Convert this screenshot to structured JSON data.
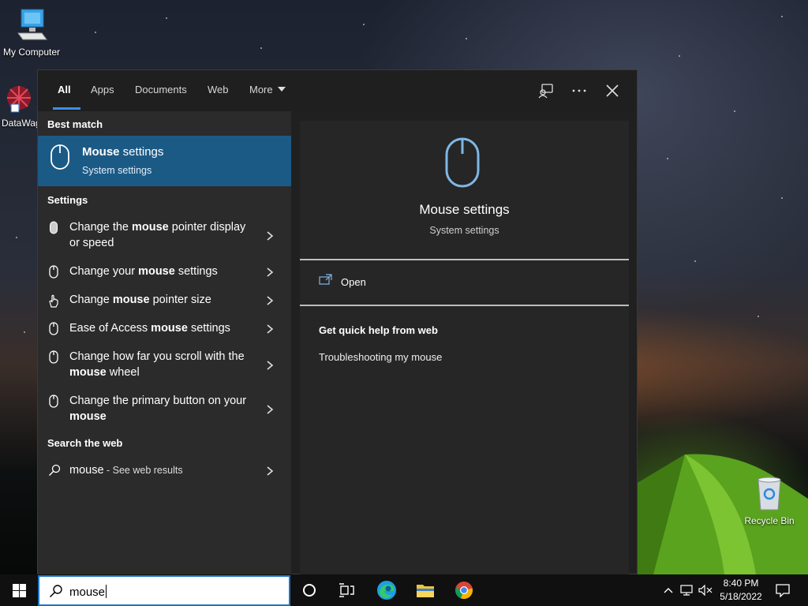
{
  "desktop": {
    "icons": [
      {
        "label": "My Computer",
        "icon": "monitor-icon"
      },
      {
        "label": "DataWag",
        "icon": "datawag-icon"
      },
      {
        "label": "Recycle Bin",
        "icon": "recycle-bin-icon"
      }
    ]
  },
  "search_panel": {
    "tabs": [
      "All",
      "Apps",
      "Documents",
      "Web",
      "More"
    ],
    "active_tab": "All",
    "best_match": {
      "heading": "Best match",
      "title_bold": "Mouse",
      "title_rest": " settings",
      "subtitle": "System settings"
    },
    "settings": {
      "heading": "Settings",
      "items": [
        {
          "pre": "Change the ",
          "bold": "mouse",
          "post": " pointer display or speed"
        },
        {
          "pre": "Change your ",
          "bold": "mouse",
          "post": " settings"
        },
        {
          "pre": "Change ",
          "bold": "mouse",
          "post": " pointer size"
        },
        {
          "pre": "Ease of Access ",
          "bold": "mouse",
          "post": " settings"
        },
        {
          "pre": "Change how far you scroll with the ",
          "bold": "mouse",
          "post": " wheel"
        },
        {
          "pre": "Change the primary button on your ",
          "bold": "mouse",
          "post": ""
        }
      ]
    },
    "web": {
      "heading": "Search the web",
      "query": "mouse",
      "suffix": " - See web results"
    },
    "preview": {
      "title": "Mouse settings",
      "subtitle": "System settings",
      "open_label": "Open",
      "quick_help_heading": "Get quick help from web",
      "quick_help_link": "Troubleshooting my mouse"
    }
  },
  "taskbar": {
    "search_value": "mouse",
    "time": "8:40 PM",
    "date": "5/18/2022"
  },
  "colors": {
    "accent": "#1c5a86",
    "tab_underline": "#3d8ee6",
    "panel_bg": "#202020"
  }
}
